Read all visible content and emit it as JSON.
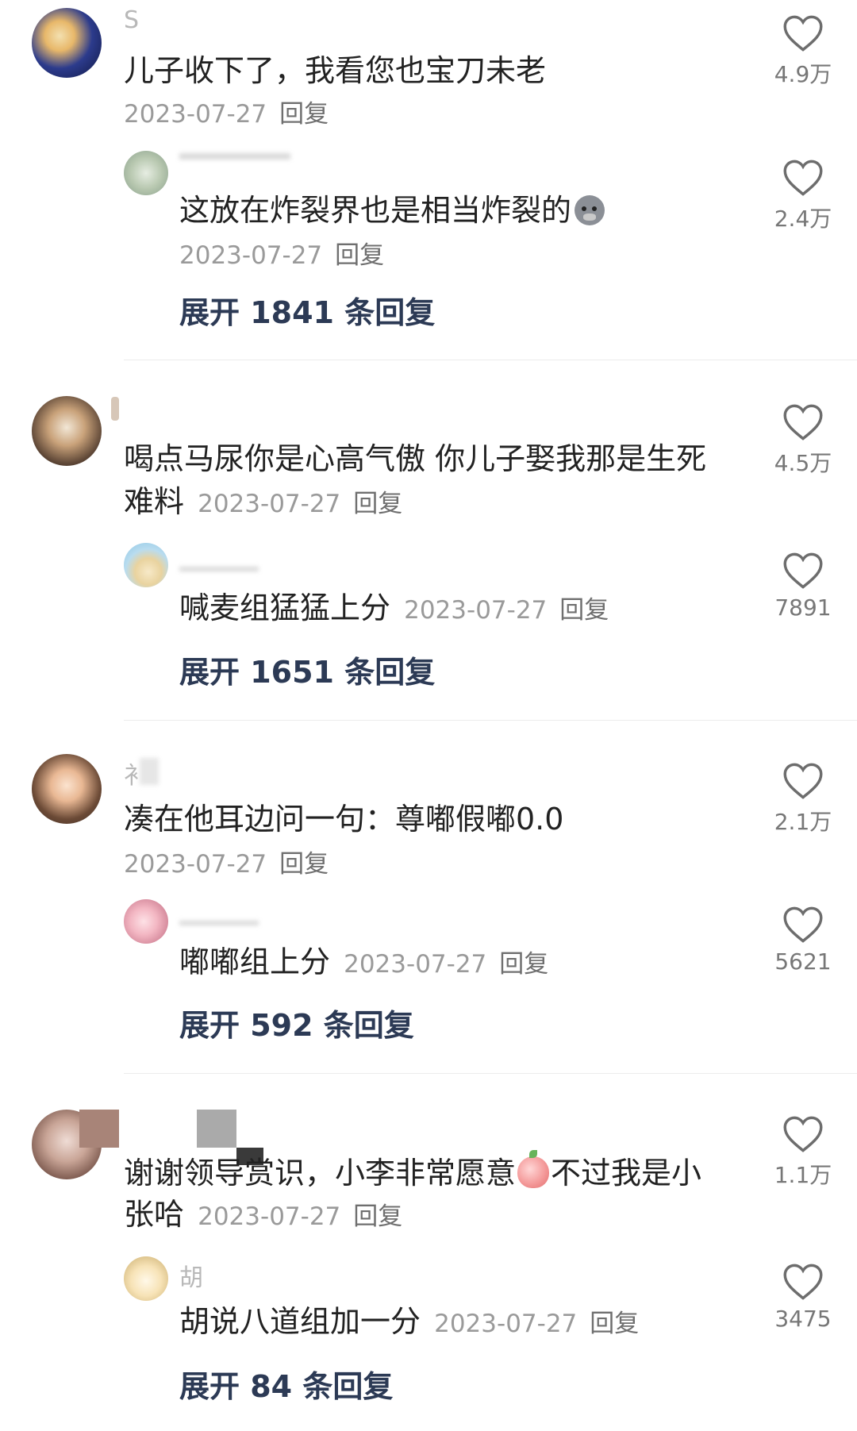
{
  "threads": [
    {
      "author": "S",
      "comment": "儿子收下了，我看您也宝刀未老",
      "date": "2023-07-27",
      "reply_label": "回复",
      "likes": "4.9万",
      "sub": {
        "text": "这放在炸裂界也是相当炸裂的",
        "date": "2023-07-27",
        "reply_label": "回复",
        "likes": "2.4万"
      },
      "expand": "展开 1841 条回复"
    },
    {
      "comment_line1": "喝点马尿你是心高气傲 你儿子娶我那是生死",
      "comment_line2": "难料",
      "date": "2023-07-27",
      "reply_label": "回复",
      "likes": "4.5万",
      "sub": {
        "text": "喊麦组猛猛上分",
        "date": "2023-07-27",
        "reply_label": "回复",
        "likes": "7891"
      },
      "expand": "展开 1651 条回复"
    },
    {
      "author": "衤",
      "comment": "凑在他耳边问一句：尊嘟假嘟0.0",
      "date": "2023-07-27",
      "reply_label": "回复",
      "likes": "2.1万",
      "sub": {
        "text": "嘟嘟组上分",
        "date": "2023-07-27",
        "reply_label": "回复",
        "likes": "5621"
      },
      "expand": "展开 592 条回复"
    },
    {
      "comment_line1": "谢谢领导赏识，小李非常愿意",
      "comment_line1b": "不过我是小",
      "comment_line2": "张哈",
      "date": "2023-07-27",
      "reply_label": "回复",
      "likes": "1.1万",
      "sub": {
        "author": "胡",
        "text": "胡说八道组加一分",
        "date": "2023-07-27",
        "reply_label": "回复",
        "likes": "3475"
      },
      "expand": "展开 84 条回复"
    }
  ],
  "icons": {
    "like": "heart-outline-icon",
    "emoji_1": "pig-face-emoji-icon",
    "emoji_2": "peach-emoji-icon"
  },
  "colors": {
    "expand_text": "#2c3a55",
    "meta_text": "#9a9a9a"
  }
}
